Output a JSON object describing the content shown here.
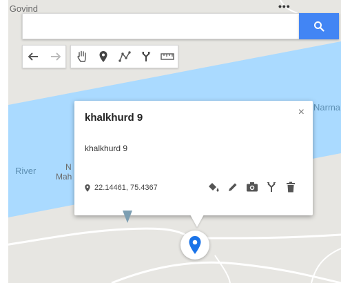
{
  "map": {
    "labels": {
      "top_left": "ni Govind",
      "left_small": "...",
      "river_left": "River",
      "near_n": "N",
      "near_mah": "Mah",
      "river_right": "Narma",
      "top_dots": "•••"
    }
  },
  "search": {
    "value": "",
    "placeholder": "",
    "icon": "search-icon"
  },
  "toolbar": {
    "tools": [
      {
        "name": "undo",
        "icon": "undo-icon"
      },
      {
        "name": "redo",
        "icon": "redo-icon"
      },
      {
        "name": "select",
        "icon": "hand-icon"
      },
      {
        "name": "add-marker",
        "icon": "marker-icon"
      },
      {
        "name": "draw-line",
        "icon": "polyline-icon"
      },
      {
        "name": "directions",
        "icon": "directions-icon"
      },
      {
        "name": "measure",
        "icon": "ruler-icon"
      }
    ]
  },
  "popup": {
    "title": "khalkhurd 9",
    "description": "khalkhurd 9",
    "coordinates": "22.14461, 75.4367",
    "close_label": "×",
    "actions": [
      "style-icon",
      "edit-icon",
      "camera-icon",
      "directions-icon",
      "delete-icon"
    ]
  },
  "colors": {
    "water": "#aadaff",
    "land": "#e7e6e2",
    "accent": "#4285f4",
    "marker": "#1a73e8",
    "small_marker": "#7c9eb2"
  }
}
